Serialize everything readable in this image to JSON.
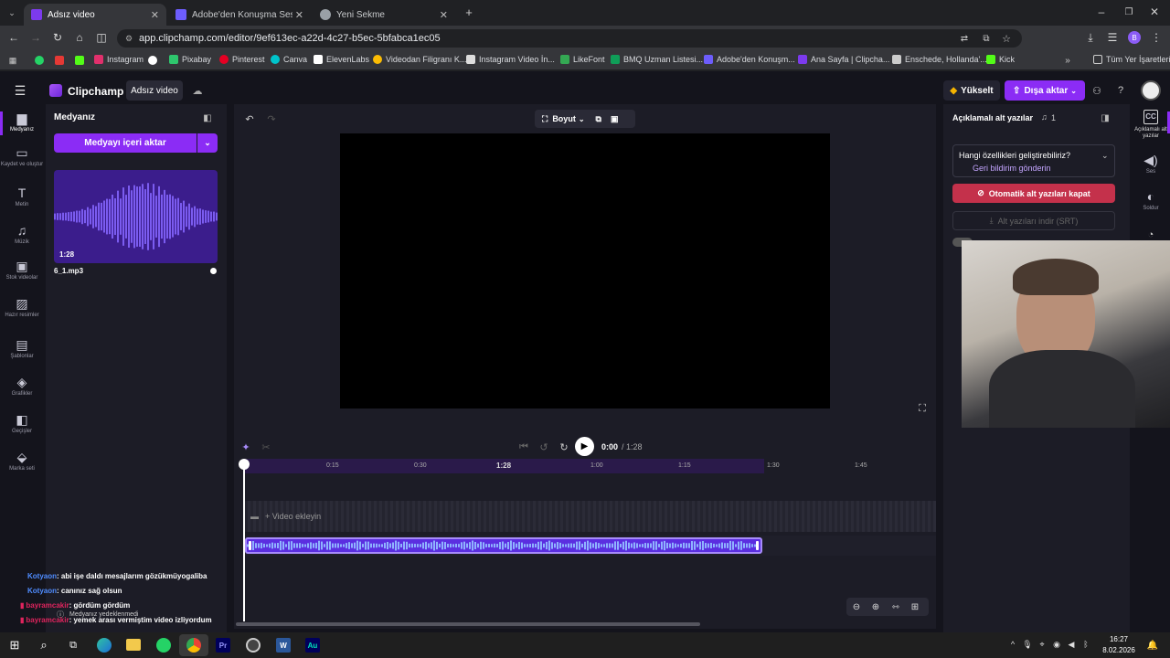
{
  "browser": {
    "tabs": [
      {
        "label": "Adsız video",
        "color": "#7c3aed"
      },
      {
        "label": "Adobe'den Konuşma Sesini İyileş",
        "color": "#6d5dfc"
      },
      {
        "label": "Yeni Sekme",
        "color": "#9aa0a6"
      }
    ],
    "url": "app.clipchamp.com/editor/9ef613ec-a22d-4c27-b5ec-5bfabca1ec05",
    "bookmarks": [
      "Instagram",
      "Pixabay",
      "Pinterest",
      "Canva",
      "ElevenLabs",
      "Videodan Filigranı K...",
      "Instagram Video İn...",
      "LikeFont",
      "BMQ Uzman Listesi...",
      "Adobe'den Konuşm...",
      "Ana Sayfa | Clipcha...",
      "Enschede, Hollanda'...",
      "Kick"
    ],
    "all_bookmarks": "Tüm Yer İşaretleri",
    "profile_initial": "B"
  },
  "app": {
    "brand": "Clipchamp",
    "project_title": "Adsız video",
    "upgrade_label": "Yükselt",
    "export_label": "Dışa aktar",
    "accent": "#8b2cf5"
  },
  "leftnav": [
    {
      "label": "Medyanız",
      "icon": "folder-icon",
      "glyph": "▆"
    },
    {
      "label": "Kaydet ve oluştur",
      "icon": "camera-icon",
      "glyph": "▭"
    },
    {
      "label": "Metin",
      "icon": "text-icon",
      "glyph": "T"
    },
    {
      "label": "Müzik",
      "icon": "music-icon",
      "glyph": "♫"
    },
    {
      "label": "Stok videolar",
      "icon": "film-icon",
      "glyph": "▣"
    },
    {
      "label": "Hazır resimler",
      "icon": "image-icon",
      "glyph": "▨"
    },
    {
      "label": "Şablonlar",
      "icon": "template-icon",
      "glyph": "▤"
    },
    {
      "label": "Grafikler",
      "icon": "shapes-icon",
      "glyph": "◈"
    },
    {
      "label": "Geçişler",
      "icon": "transition-icon",
      "glyph": "◧"
    },
    {
      "label": "Marka seti",
      "icon": "brand-kit-icon",
      "glyph": "⬙"
    }
  ],
  "media": {
    "title": "Medyanız",
    "import_label": "Medyayı içeri aktar",
    "item_duration": "1:28",
    "item_name": "6_1.mp3",
    "footer": "Medyanız yedeklenmedi"
  },
  "stage": {
    "size_label": "Boyut"
  },
  "timeline": {
    "time_current": "0:00",
    "time_total": "/ 1:28",
    "ruler": [
      "0:15",
      "0:30",
      "1:28",
      "1:00",
      "1:15",
      "1:30",
      "1:45"
    ],
    "add_video_label": "+ Video ekleyin"
  },
  "captions": {
    "title": "Açıklamalı alt yazılar",
    "count": "1",
    "feedback_question": "Hangi özellikleri geliştirebiliriz?",
    "feedback_link": "Geri bildirim gönderin",
    "disable_label": "Otomatik alt yazıları kapat",
    "download_label": "Alt yazıları indir (SRT)"
  },
  "rightnav": [
    {
      "label": "Açıklamalı alt yazılar",
      "icon": "captions-icon",
      "glyph": "CC"
    },
    {
      "label": "Ses",
      "icon": "volume-icon",
      "glyph": "🔊"
    },
    {
      "label": "Soldur",
      "icon": "fade-icon",
      "glyph": "◐"
    }
  ],
  "chat": [
    {
      "user": "Kotyaon",
      "text": ": abi işe daldı mesajlarım gözükmüyogaliba",
      "color": "#4f8cff"
    },
    {
      "user": "Kotyaon",
      "text": ": canınız sağ olsun",
      "color": "#4f8cff"
    },
    {
      "user": "bayramcakir",
      "text": ": gördüm gördüm",
      "color": "#e0245e"
    },
    {
      "user": "bayramcakir",
      "text": ": yemek arası vermiştim video izliyordum",
      "color": "#e0245e"
    }
  ],
  "taskbar": {
    "time": "16:27",
    "date": "8.02.2026"
  }
}
